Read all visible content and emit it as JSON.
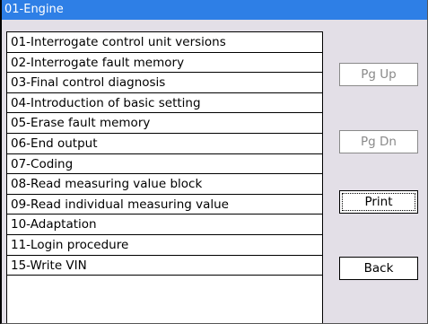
{
  "window": {
    "title": "01-Engine"
  },
  "menu": {
    "items": [
      {
        "label": "01-Interrogate control unit versions"
      },
      {
        "label": "02-Interrogate fault memory"
      },
      {
        "label": "03-Final control diagnosis"
      },
      {
        "label": "04-Introduction of basic setting"
      },
      {
        "label": "05-Erase fault memory"
      },
      {
        "label": "06-End output"
      },
      {
        "label": "07-Coding"
      },
      {
        "label": "08-Read measuring value block"
      },
      {
        "label": "09-Read individual measuring value"
      },
      {
        "label": "10-Adaptation"
      },
      {
        "label": "11-Login procedure"
      },
      {
        "label": "15-Write VIN"
      }
    ]
  },
  "buttons": {
    "pg_up": "Pg Up",
    "pg_dn": "Pg Dn",
    "print": "Print",
    "back": "Back"
  },
  "colors": {
    "title_bar": "#2e7fe6",
    "window_bg": "#e3dfe7",
    "disabled_text": "#8a8a8a"
  }
}
